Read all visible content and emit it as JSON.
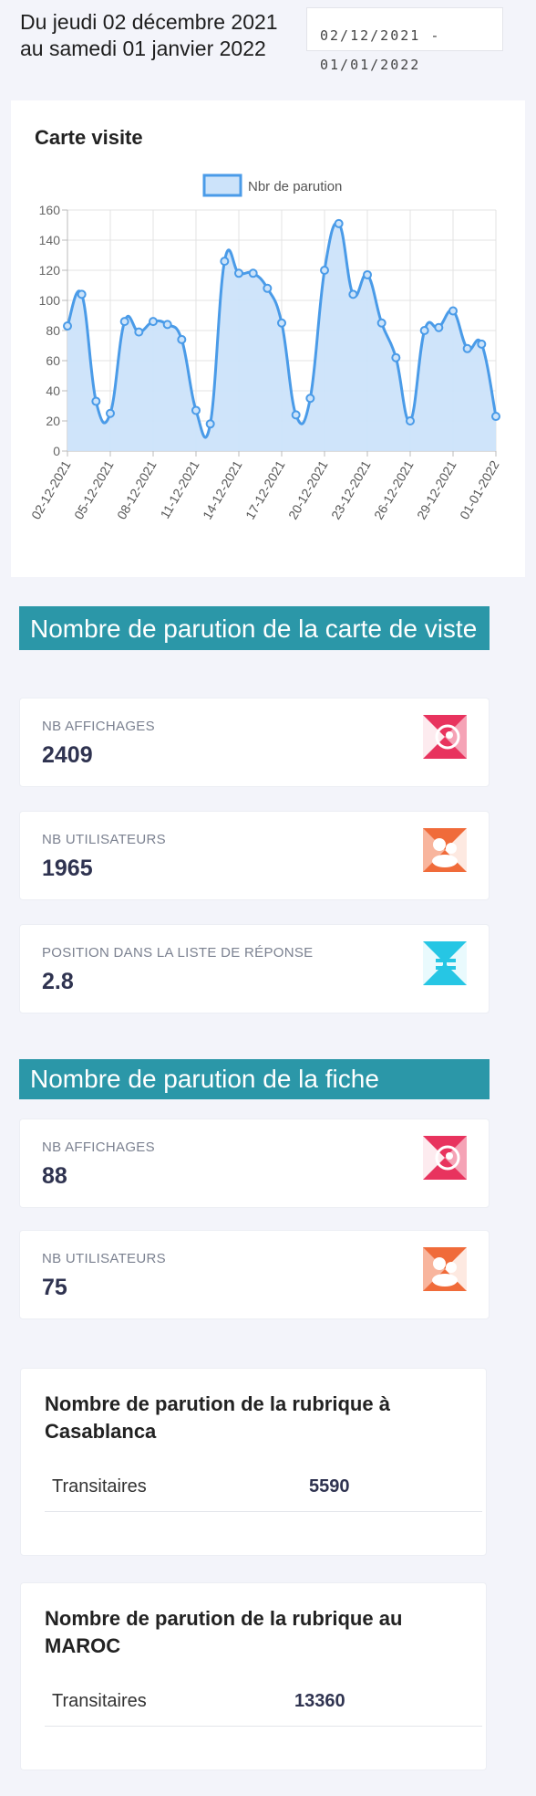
{
  "header": {
    "title": "Du jeudi 02 décembre 2021 au samedi 01 janvier 2022",
    "date_range": "02/12/2021 - 01/01/2022"
  },
  "chart_card": {
    "title": "Carte visite"
  },
  "chart_data": {
    "type": "area",
    "legend": [
      "Nbr de parution"
    ],
    "legend_position": "top",
    "grid": true,
    "ylim": [
      0,
      160
    ],
    "yticks": [
      0,
      20,
      40,
      60,
      80,
      100,
      120,
      140,
      160
    ],
    "x": [
      "02-12-2021",
      "03-12-2021",
      "04-12-2021",
      "05-12-2021",
      "06-12-2021",
      "07-12-2021",
      "08-12-2021",
      "09-12-2021",
      "10-12-2021",
      "11-12-2021",
      "12-12-2021",
      "13-12-2021",
      "14-12-2021",
      "15-12-2021",
      "16-12-2021",
      "17-12-2021",
      "18-12-2021",
      "19-12-2021",
      "20-12-2021",
      "21-12-2021",
      "22-12-2021",
      "23-12-2021",
      "24-12-2021",
      "25-12-2021",
      "26-12-2021",
      "27-12-2021",
      "28-12-2021",
      "29-12-2021",
      "30-12-2021",
      "31-12-2021",
      "01-01-2022"
    ],
    "xtick_labels": [
      "02-12-2021",
      "05-12-2021",
      "08-12-2021",
      "11-12-2021",
      "14-12-2021",
      "17-12-2021",
      "20-12-2021",
      "23-12-2021",
      "26-12-2021",
      "29-12-2021",
      "01-01-2022"
    ],
    "series": [
      {
        "name": "Nbr de parution",
        "color": "#4a9be8",
        "fill": "#cce3fa",
        "values": [
          83,
          104,
          33,
          25,
          86,
          79,
          86,
          84,
          74,
          27,
          18,
          126,
          118,
          118,
          108,
          85,
          24,
          35,
          120,
          151,
          104,
          117,
          85,
          62,
          20,
          80,
          82,
          93,
          68,
          71,
          23
        ]
      }
    ]
  },
  "carte_section": {
    "title": "Nombre de parution de la carte de viste",
    "stats": [
      {
        "label": "NB AFFICHAGES",
        "value": "2409",
        "icon": "eye-icon",
        "color": "#e8335e"
      },
      {
        "label": "NB UTILISATEURS",
        "value": "1965",
        "icon": "users-icon",
        "color": "#f06b3a"
      },
      {
        "label": "POSITION DANS LA LISTE DE RÉPONSE",
        "value": "2.8",
        "icon": "list-position-icon",
        "color": "#26c6e4"
      }
    ]
  },
  "fiche_section": {
    "title": "Nombre de parution de la fiche",
    "stats": [
      {
        "label": "NB AFFICHAGES",
        "value": "88",
        "icon": "eye-icon",
        "color": "#e8335e"
      },
      {
        "label": "NB UTILISATEURS",
        "value": "75",
        "icon": "users-icon",
        "color": "#f06b3a"
      }
    ]
  },
  "rubrique_casablanca": {
    "title": "Nombre de parution de la rubrique à Casablanca",
    "rows": [
      {
        "name": "Transitaires",
        "value": "5590"
      }
    ]
  },
  "rubrique_maroc": {
    "title": "Nombre de parution de la rubrique au MAROC",
    "rows": [
      {
        "name": "Transitaires",
        "value": "13360"
      }
    ]
  }
}
